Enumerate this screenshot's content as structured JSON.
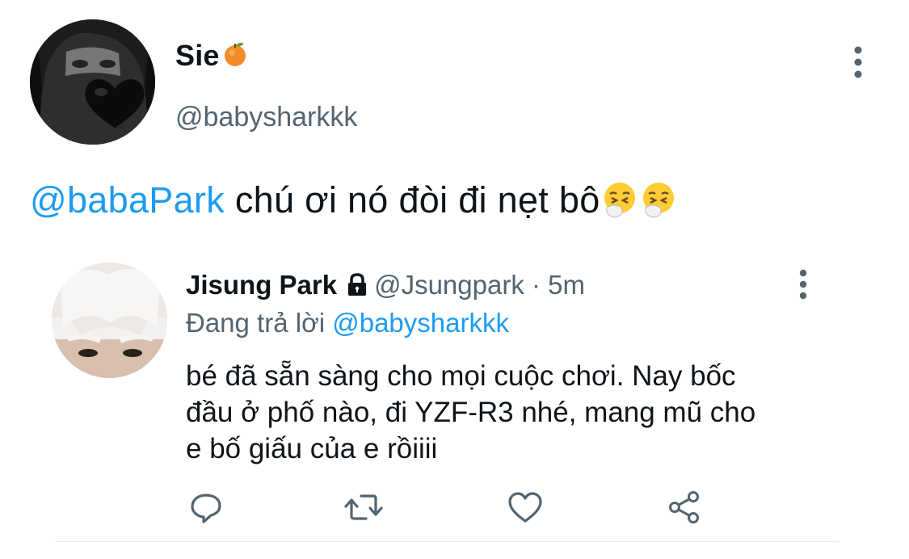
{
  "tweet": {
    "display_name": "Sie",
    "handle": "@babysharkkk",
    "mention": "@babaPark",
    "text": " chú ơi nó đòi đi nẹt bô",
    "emoji_icons": [
      "sneezing-face-emoji",
      "sneezing-face-emoji"
    ]
  },
  "reply": {
    "display_name": "Jisung Park",
    "handle": "@Jsungpark",
    "separator": " · ",
    "time": "5m",
    "replying_prefix": "Đang trả lời ",
    "replying_to": "@babysharkkk",
    "text_lines": [
      "bé đã sẵn sàng cho mọi cuộc chơi. Nay bốc",
      "đầu ở phố nào, đi YZF-R3 nhé, mang mũ cho",
      "e bố giấu của e rồiiii"
    ]
  },
  "actions": [
    "reply-icon",
    "retweet-icon",
    "like-icon",
    "share-icon"
  ],
  "colors": {
    "accent": "#1d9bf0",
    "secondary_text": "#536471",
    "icon": "#536471"
  }
}
